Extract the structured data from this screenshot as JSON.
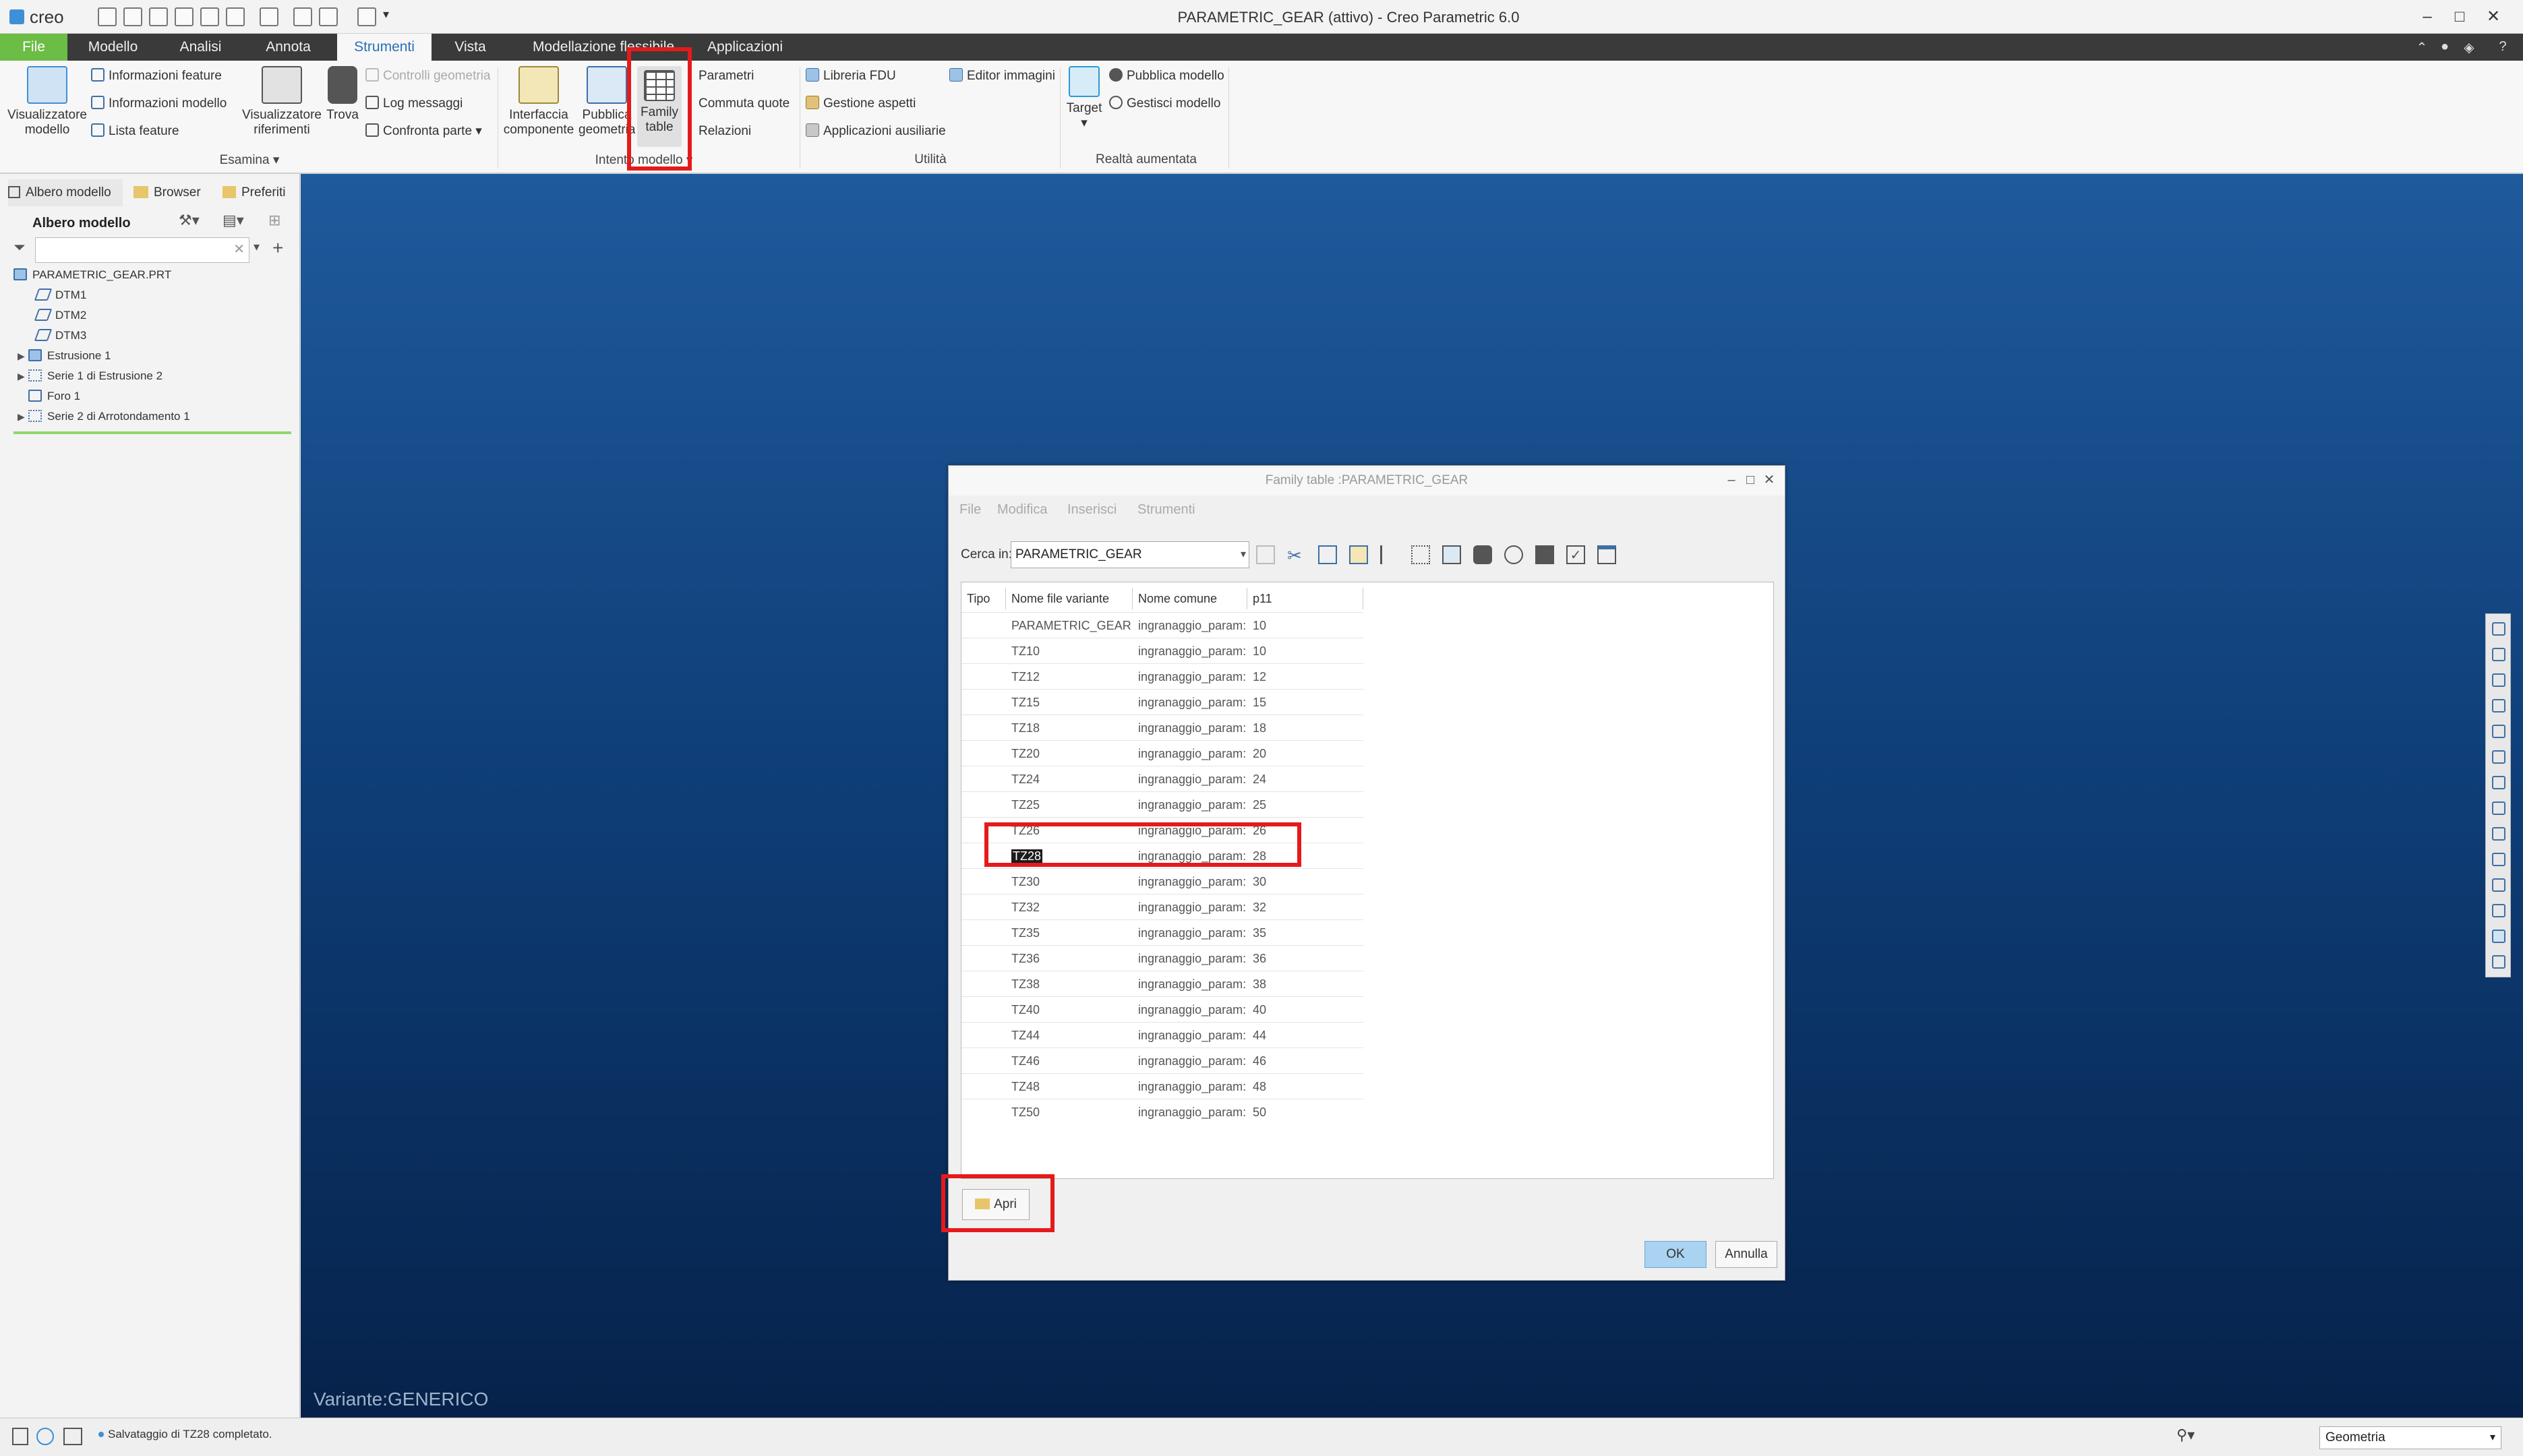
{
  "window": {
    "title": "PARAMETRIC_GEAR (attivo) - Creo Parametric 6.0",
    "app": "creo"
  },
  "ribbon_tabs": [
    "File",
    "Modello",
    "Analisi",
    "Annota",
    "Strumenti",
    "Vista",
    "Modellazione flessibile",
    "Applicazioni"
  ],
  "ribbon": {
    "esamina": {
      "visualizzatore": "Visualizzatore modello",
      "info_feature": "Informazioni feature",
      "info_modello": "Informazioni modello",
      "lista_feature": "Lista feature",
      "vis_riferimenti": "Visualizzatore riferimenti",
      "trova": "Trova",
      "controlli": "Controlli geometria",
      "log": "Log messaggi",
      "confronta": "Confronta parte",
      "group": "Esamina"
    },
    "intento": {
      "interfaccia": "Interfaccia componente",
      "pubblica": "Pubblica geometria",
      "family": "Family table",
      "parametri": "Parametri",
      "commuta": "Commuta quote",
      "relazioni": "Relazioni",
      "group": "Intento modello"
    },
    "utilita": {
      "libreria": "Libreria FDU",
      "editor": "Editor immagini",
      "gestione": "Gestione aspetti",
      "applicazioni": "Applicazioni ausiliarie",
      "group": "Utilità"
    },
    "realta": {
      "target": "Target",
      "pubblica": "Pubblica modello",
      "gestisci": "Gestisci modello",
      "group": "Realtà aumentata"
    }
  },
  "left_panel": {
    "tabs": [
      "Albero modello",
      "Browser",
      "Preferiti"
    ],
    "tree_title": "Albero modello",
    "tree": [
      "PARAMETRIC_GEAR.PRT",
      "DTM1",
      "DTM2",
      "DTM3",
      "Estrusione 1",
      "Serie 1 di Estrusione 2",
      "Foro 1",
      "Serie 2 di Arrotondamento 1"
    ]
  },
  "viewport": {
    "variant_label": "Variante:GENERICO"
  },
  "status": {
    "message": "Salvataggio di TZ28 completato.",
    "filter": "Geometria"
  },
  "dialog": {
    "title": "Family table :PARAMETRIC_GEAR",
    "menu": [
      "File",
      "Modifica",
      "Inserisci",
      "Strumenti"
    ],
    "cerca_label": "Cerca in:",
    "cerca_value": "PARAMETRIC_GEAR",
    "columns": [
      "Tipo",
      "Nome file variante",
      "Nome comune",
      "p11"
    ],
    "rows": [
      {
        "name": "PARAMETRIC_GEAR",
        "common": "ingranaggio_param:",
        "p11": "10"
      },
      {
        "name": "TZ10",
        "common": "ingranaggio_param:",
        "p11": "10"
      },
      {
        "name": "TZ12",
        "common": "ingranaggio_param:",
        "p11": "12"
      },
      {
        "name": "TZ15",
        "common": "ingranaggio_param:",
        "p11": "15"
      },
      {
        "name": "TZ18",
        "common": "ingranaggio_param:",
        "p11": "18"
      },
      {
        "name": "TZ20",
        "common": "ingranaggio_param:",
        "p11": "20"
      },
      {
        "name": "TZ24",
        "common": "ingranaggio_param:",
        "p11": "24"
      },
      {
        "name": "TZ25",
        "common": "ingranaggio_param:",
        "p11": "25"
      },
      {
        "name": "TZ26",
        "common": "ingranaggio_param:",
        "p11": "26"
      },
      {
        "name": "TZ28",
        "common": "ingranaggio_param:",
        "p11": "28"
      },
      {
        "name": "TZ30",
        "common": "ingranaggio_param:",
        "p11": "30"
      },
      {
        "name": "TZ32",
        "common": "ingranaggio_param:",
        "p11": "32"
      },
      {
        "name": "TZ35",
        "common": "ingranaggio_param:",
        "p11": "35"
      },
      {
        "name": "TZ36",
        "common": "ingranaggio_param:",
        "p11": "36"
      },
      {
        "name": "TZ38",
        "common": "ingranaggio_param:",
        "p11": "38"
      },
      {
        "name": "TZ40",
        "common": "ingranaggio_param:",
        "p11": "40"
      },
      {
        "name": "TZ44",
        "common": "ingranaggio_param:",
        "p11": "44"
      },
      {
        "name": "TZ46",
        "common": "ingranaggio_param:",
        "p11": "46"
      },
      {
        "name": "TZ48",
        "common": "ingranaggio_param:",
        "p11": "48"
      },
      {
        "name": "TZ50",
        "common": "ingranaggio_param:",
        "p11": "50"
      }
    ],
    "open_label": "Apri",
    "ok_label": "OK",
    "cancel_label": "Annulla"
  },
  "colors": {
    "accent": "#2a6fb8",
    "file_tab": "#6bbd45",
    "highlight": "#e51a1a",
    "ok": "#a9d3f1"
  }
}
